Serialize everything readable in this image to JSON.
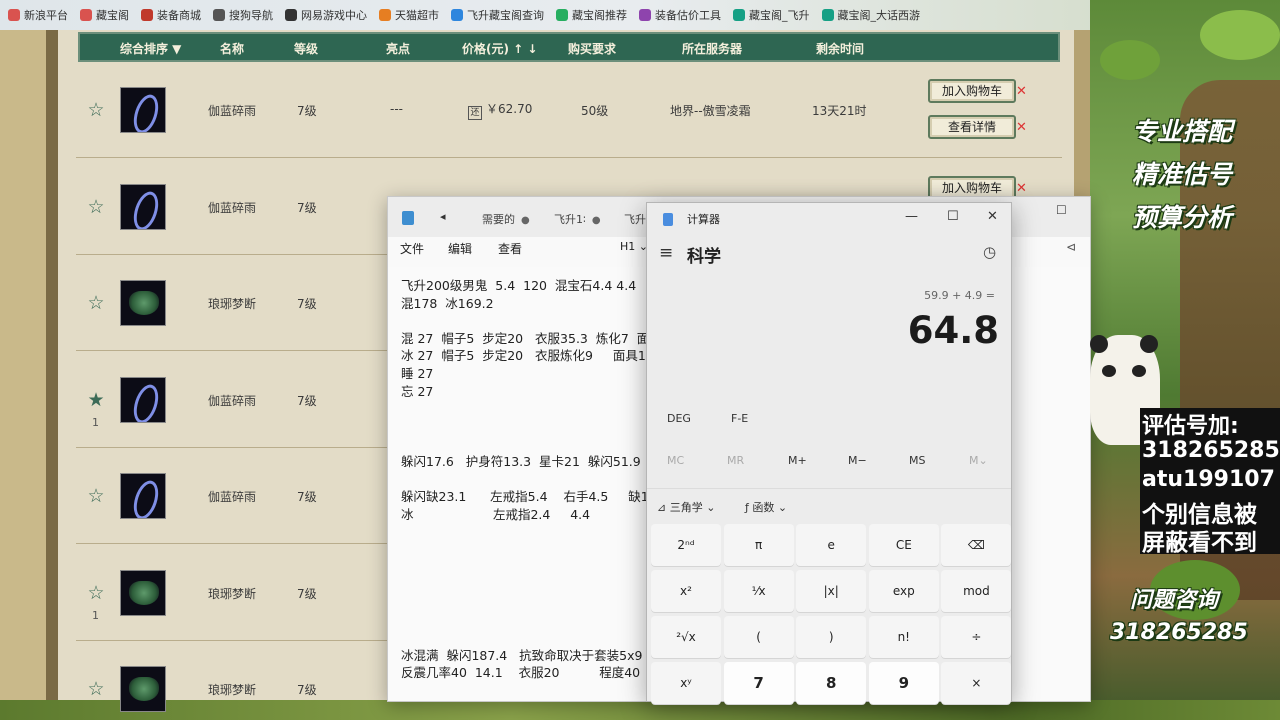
{
  "bookmarks": [
    {
      "label": "新浪平台",
      "color": "#d9534f"
    },
    {
      "label": "藏宝阁",
      "color": "#d9534f"
    },
    {
      "label": "装备商城",
      "color": "#c0392b"
    },
    {
      "label": "搜狗导航",
      "color": "#555555"
    },
    {
      "label": "网易游戏中心",
      "color": "#333333"
    },
    {
      "label": "天猫超市",
      "color": "#e67e22"
    },
    {
      "label": "飞升藏宝阁查询",
      "color": "#2e86de"
    },
    {
      "label": "藏宝阁推荐",
      "color": "#27ae60"
    },
    {
      "label": "装备估价工具",
      "color": "#8e44ad"
    },
    {
      "label": "藏宝阁_飞升",
      "color": "#16a085"
    },
    {
      "label": "藏宝阁_大话西游",
      "color": "#16a085"
    }
  ],
  "table": {
    "headers": {
      "sort": "综合排序 ▼",
      "name": "名称",
      "level": "等级",
      "highlight": "亮点",
      "price": "价格(元)",
      "price_arrows": "↑ ↓",
      "requirement": "购买要求",
      "server": "所在服务器",
      "remaining": "剩余时间"
    },
    "rows": [
      {
        "star_filled": false,
        "star_count": "",
        "thumb": "dragon",
        "name": "伽蓝碎雨",
        "level": "7级",
        "highlight": "---",
        "price_tag": "还",
        "price": "￥62.70",
        "requirement": "50级",
        "server": "地界--傲雪凌霜",
        "remaining": "13天21时",
        "btn_cart": "加入购物车",
        "btn_detail": "查看详情",
        "show_buttons": true
      },
      {
        "star_filled": false,
        "star_count": "",
        "thumb": "dragon",
        "name": "伽蓝碎雨",
        "level": "7级",
        "btn_cart": "加入购物车",
        "show_buttons": "partial"
      },
      {
        "star_filled": false,
        "star_count": "",
        "thumb": "mask",
        "name": "琅琊梦断",
        "level": "7级"
      },
      {
        "star_filled": true,
        "star_count": "1",
        "thumb": "dragon",
        "name": "伽蓝碎雨",
        "level": "7级"
      },
      {
        "star_filled": false,
        "star_count": "",
        "thumb": "dragon",
        "name": "伽蓝碎雨",
        "level": "7级"
      },
      {
        "star_filled": false,
        "star_count": "1",
        "thumb": "mask",
        "name": "琅琊梦断",
        "level": "7级"
      },
      {
        "star_filled": false,
        "star_count": "",
        "thumb": "mask",
        "name": "琅琊梦断",
        "level": "7级"
      }
    ]
  },
  "notepad": {
    "back_arrow": "◂",
    "tabs": [
      {
        "label": "需要的",
        "dot": "●"
      },
      {
        "label": "飞升1∶",
        "dot": "●"
      },
      {
        "label": "飞升",
        "dot": ""
      }
    ],
    "maximize": "☐",
    "menu": {
      "file": "文件",
      "edit": "编辑",
      "view": "查看",
      "heading": "H1 ⌄",
      "share": "⊲"
    },
    "lines": [
      "飞升200级男鬼  5.4  120  混宝石4.4 4.4",
      "混178  冰169.2",
      "",
      "混 27  帽子5  步定20   衣服35.3  炼化7  面",
      "冰 27  帽子5  步定20   衣服炼化9     面具1",
      "睡 27",
      "忘 27",
      "",
      "",
      "",
      "躲闪17.6   护身符13.3  星卡21  躲闪51.9",
      "",
      "躲闪缺23.1      左戒指5.4    右手4.5     缺1",
      "冰                    左戒指2.4     4.4",
      "",
      "",
      "",
      "",
      "",
      "",
      "",
      "冰混满  躲闪187.4   抗致命取决于套装5x9",
      "反震几率40  14.1    衣服20          程度40"
    ]
  },
  "calculator": {
    "title": "计算器",
    "window_buttons": {
      "minimize": "—",
      "maximize": "☐",
      "close": "✕"
    },
    "menu_icon": "≡",
    "mode": "科学",
    "history_icon": "◷",
    "expression": "59.9 + 4.9 =",
    "result": "64.8",
    "angle_mode": "DEG",
    "notation": "F-E",
    "memory": [
      {
        "label": "MC",
        "enabled": false
      },
      {
        "label": "MR",
        "enabled": false
      },
      {
        "label": "M+",
        "enabled": true
      },
      {
        "label": "M−",
        "enabled": true
      },
      {
        "label": "MS",
        "enabled": true
      },
      {
        "label": "M⌄",
        "enabled": false
      }
    ],
    "trig_label": "⊿ 三角学 ⌄",
    "func_label": "ƒ  函数 ⌄",
    "keys": [
      [
        "2ⁿᵈ",
        "π",
        "e",
        "CE",
        "⌫"
      ],
      [
        "x²",
        "¹⁄x",
        "|x|",
        "exp",
        "mod"
      ],
      [
        "²√x",
        "(",
        ")",
        "n!",
        "÷"
      ],
      [
        "xʸ",
        "7",
        "8",
        "9",
        "×"
      ]
    ]
  },
  "promo": {
    "lines": [
      "专业搭配",
      "精准估号",
      "预算分析"
    ],
    "info": [
      "评估号加:",
      "318265285",
      "atu199107",
      "个别信息被",
      "屏蔽看不到"
    ],
    "consult": "问题咨询",
    "consult_number": "318265285"
  }
}
